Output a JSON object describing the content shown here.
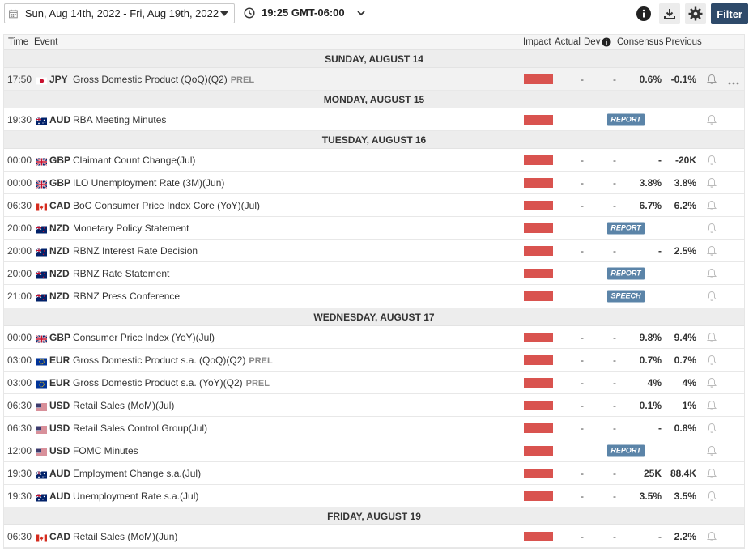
{
  "toolbar": {
    "date_range": "Sun, Aug 14th, 2022 -  Fri, Aug 19th, 2022",
    "timezone": "19:25 GMT-06:00",
    "filter_label": "Filter"
  },
  "columns": {
    "time": "Time",
    "event": "Event",
    "impact": "Impact",
    "actual": "Actual",
    "dev": "Dev",
    "consensus": "Consensus",
    "previous": "Previous"
  },
  "colors": {
    "impact_high": "#d9534f",
    "badge": "#5b84a8",
    "filter_bg": "#2e4a6a"
  },
  "groups": [
    {
      "day": "SUNDAY, AUGUST 14",
      "rows": [
        {
          "time": "17:50",
          "flag": "jp",
          "ccy": "JPY",
          "name": "Gross Domestic Product (QoQ)(Q2)",
          "prel": "PREL",
          "actual": "-",
          "dev": "-",
          "consensus": "0.6%",
          "previous": "-0.1%",
          "more": true,
          "highlight": true
        }
      ]
    },
    {
      "day": "MONDAY, AUGUST 15",
      "rows": [
        {
          "time": "19:30",
          "flag": "au",
          "ccy": "AUD",
          "name": "RBA Meeting Minutes",
          "badge": "REPORT"
        }
      ]
    },
    {
      "day": "TUESDAY, AUGUST 16",
      "rows": [
        {
          "time": "00:00",
          "flag": "gb",
          "ccy": "GBP",
          "name": "Claimant Count Change(Jul)",
          "actual": "-",
          "dev": "-",
          "consensus": "-",
          "previous": "-20K"
        },
        {
          "time": "00:00",
          "flag": "gb",
          "ccy": "GBP",
          "name": "ILO Unemployment Rate (3M)(Jun)",
          "actual": "-",
          "dev": "-",
          "consensus": "3.8%",
          "previous": "3.8%"
        },
        {
          "time": "06:30",
          "flag": "ca",
          "ccy": "CAD",
          "name": "BoC Consumer Price Index Core (YoY)(Jul)",
          "actual": "-",
          "dev": "-",
          "consensus": "6.7%",
          "previous": "6.2%"
        },
        {
          "time": "20:00",
          "flag": "nz",
          "ccy": "NZD",
          "name": "Monetary Policy Statement",
          "badge": "REPORT"
        },
        {
          "time": "20:00",
          "flag": "nz",
          "ccy": "NZD",
          "name": "RBNZ Interest Rate Decision",
          "actual": "-",
          "dev": "-",
          "consensus": "-",
          "previous": "2.5%"
        },
        {
          "time": "20:00",
          "flag": "nz",
          "ccy": "NZD",
          "name": "RBNZ Rate Statement",
          "badge": "REPORT"
        },
        {
          "time": "21:00",
          "flag": "nz",
          "ccy": "NZD",
          "name": "RBNZ Press Conference",
          "badge": "SPEECH"
        }
      ]
    },
    {
      "day": "WEDNESDAY, AUGUST 17",
      "rows": [
        {
          "time": "00:00",
          "flag": "gb",
          "ccy": "GBP",
          "name": "Consumer Price Index (YoY)(Jul)",
          "actual": "-",
          "dev": "-",
          "consensus": "9.8%",
          "previous": "9.4%"
        },
        {
          "time": "03:00",
          "flag": "eu",
          "ccy": "EUR",
          "name": "Gross Domestic Product s.a. (QoQ)(Q2)",
          "prel": "PREL",
          "actual": "-",
          "dev": "-",
          "consensus": "0.7%",
          "previous": "0.7%"
        },
        {
          "time": "03:00",
          "flag": "eu",
          "ccy": "EUR",
          "name": "Gross Domestic Product s.a. (YoY)(Q2)",
          "prel": "PREL",
          "actual": "-",
          "dev": "-",
          "consensus": "4%",
          "previous": "4%"
        },
        {
          "time": "06:30",
          "flag": "us",
          "ccy": "USD",
          "name": "Retail Sales (MoM)(Jul)",
          "actual": "-",
          "dev": "-",
          "consensus": "0.1%",
          "previous": "1%"
        },
        {
          "time": "06:30",
          "flag": "us",
          "ccy": "USD",
          "name": "Retail Sales Control Group(Jul)",
          "actual": "-",
          "dev": "-",
          "consensus": "-",
          "previous": "0.8%"
        },
        {
          "time": "12:00",
          "flag": "us",
          "ccy": "USD",
          "name": "FOMC Minutes",
          "badge": "REPORT"
        },
        {
          "time": "19:30",
          "flag": "au",
          "ccy": "AUD",
          "name": "Employment Change s.a.(Jul)",
          "actual": "-",
          "dev": "-",
          "consensus": "25K",
          "previous": "88.4K"
        },
        {
          "time": "19:30",
          "flag": "au",
          "ccy": "AUD",
          "name": "Unemployment Rate s.a.(Jul)",
          "actual": "-",
          "dev": "-",
          "consensus": "3.5%",
          "previous": "3.5%"
        }
      ]
    },
    {
      "day": "FRIDAY, AUGUST 19",
      "rows": [
        {
          "time": "06:30",
          "flag": "ca",
          "ccy": "CAD",
          "name": "Retail Sales (MoM)(Jun)",
          "actual": "-",
          "dev": "-",
          "consensus": "-",
          "previous": "2.2%"
        }
      ]
    }
  ]
}
